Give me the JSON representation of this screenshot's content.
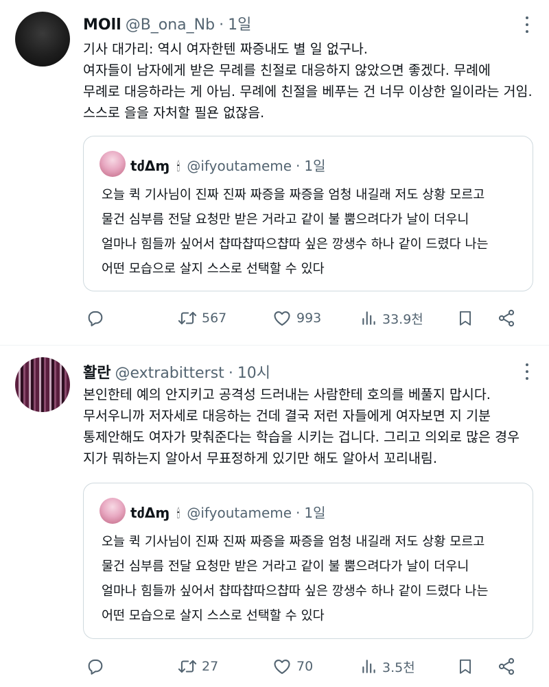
{
  "tweets": [
    {
      "display_name": "MOll",
      "handle": "@B_ona_Nb",
      "time": "1일",
      "lines": [
        "기사 대가리: 역시 여자한텐 짜증내도 별 일 없구나.",
        "여자들이 남자에게 받은 무례를 친절로 대응하지 않았으면 좋겠다. 무례에",
        "무례로 대응하라는 게 아님. 무례에 친절을 베푸는 건 너무 이상한 일이라는 거임.",
        "스스로 을을 자처할 필욘 없잖음."
      ],
      "quote": {
        "display_name": "tძΔɱ",
        "emoji": "🕯",
        "handle": "@ifyoutameme",
        "time": "1일",
        "lines": [
          "오늘 퀵 기사님이 진짜 진짜 짜증을 짜증을 엄청 내길래 저도 상황 모르고",
          "물건 심부름 전달 요청만 받은 거라고 같이 불 뿜으려다가 날이 더우니",
          "얼마나 힘들까 싶어서 챱따챱따으챱따 싶은 깡생수 하나 같이 드렸다 나는",
          "어떤 모습으로 살지 스스로 선택할 수 있다"
        ]
      },
      "stats": {
        "retweets": "567",
        "likes": "993",
        "views": "33.9천"
      }
    },
    {
      "display_name": "활란",
      "handle": "@extrabitterst",
      "time": "10시",
      "lines": [
        "본인한테 예의 안지키고 공격성 드러내는 사람한테 호의를 베풀지 맙시다.",
        "무서우니까 저자세로 대응하는 건데  결국 저런 자들에게 여자보면 지 기분",
        "통제안해도 여자가 맞춰준다는 학습을 시키는 겁니다. 그리고 의외로 많은 경우",
        "지가 뭐하는지 알아서 무표정하게  있기만 해도 알아서 꼬리내림."
      ],
      "quote": {
        "display_name": "tძΔɱ",
        "emoji": "🕯",
        "handle": "@ifyoutameme",
        "time": "1일",
        "lines": [
          "오늘 퀵 기사님이 진짜 진짜 짜증을 짜증을 엄청 내길래 저도 상황 모르고",
          "물건 심부름 전달 요청만 받은 거라고 같이 불 뿜으려다가 날이 더우니",
          "얼마나 힘들까 싶어서 챱따챱따으챱따 싶은 깡생수 하나 같이 드렸다 나는",
          "어떤 모습으로 살지 스스로 선택할 수 있다"
        ]
      },
      "stats": {
        "retweets": "27",
        "likes": "70",
        "views": "3.5천"
      }
    }
  ],
  "dot_separator": "·",
  "icons": [
    "reply-icon",
    "retweet-icon",
    "like-icon",
    "views-icon",
    "bookmark-icon",
    "share-icon",
    "more-icon"
  ],
  "colors": {
    "text": "#0f1419",
    "secondary": "#536471",
    "border": "#cfd9de"
  }
}
